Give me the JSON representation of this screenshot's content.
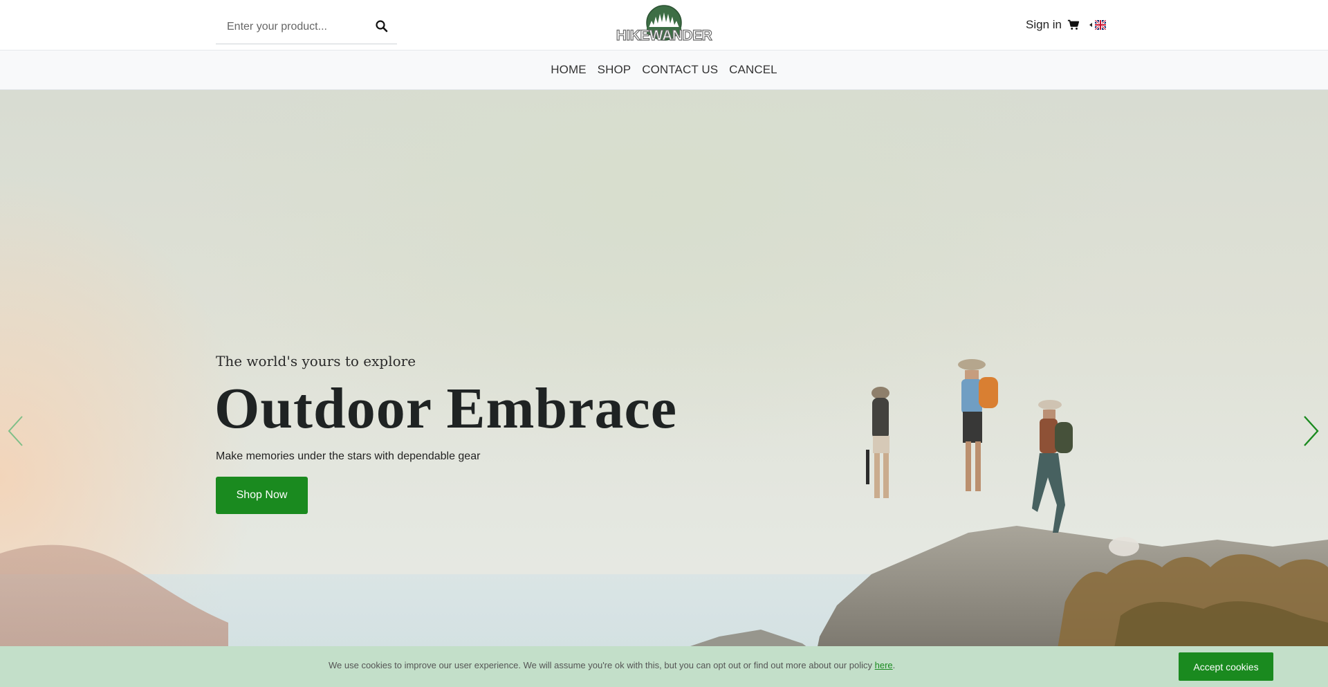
{
  "header": {
    "search": {
      "placeholder": "Enter your product...",
      "value": ""
    },
    "logo_text": "HIKEWANDER",
    "signin_label": "Sign in",
    "cart_icon": "shopping-cart-icon",
    "language_flag": "uk-flag-icon"
  },
  "nav": {
    "items": [
      {
        "label": "HOME"
      },
      {
        "label": "SHOP"
      },
      {
        "label": "CONTACT US"
      },
      {
        "label": "CANCEL"
      }
    ]
  },
  "hero": {
    "pretitle": "The world's yours to explore",
    "title": "Outdoor Embrace",
    "subtitle": "Make memories under the stars with dependable gear",
    "button_label": "Shop Now",
    "prev_icon": "chevron-left-icon",
    "next_icon": "chevron-right-icon"
  },
  "cookie": {
    "text": "We use cookies to improve our user experience. We will assume you're ok with this, but you can opt out or find out more about our policy",
    "link_label": "here",
    "suffix": ".",
    "button_label": "Accept cookies"
  },
  "colors": {
    "brand_green": "#1a8a1f",
    "cookie_bar": "#c3dfc9",
    "nav_bg": "#f8f9fa"
  }
}
